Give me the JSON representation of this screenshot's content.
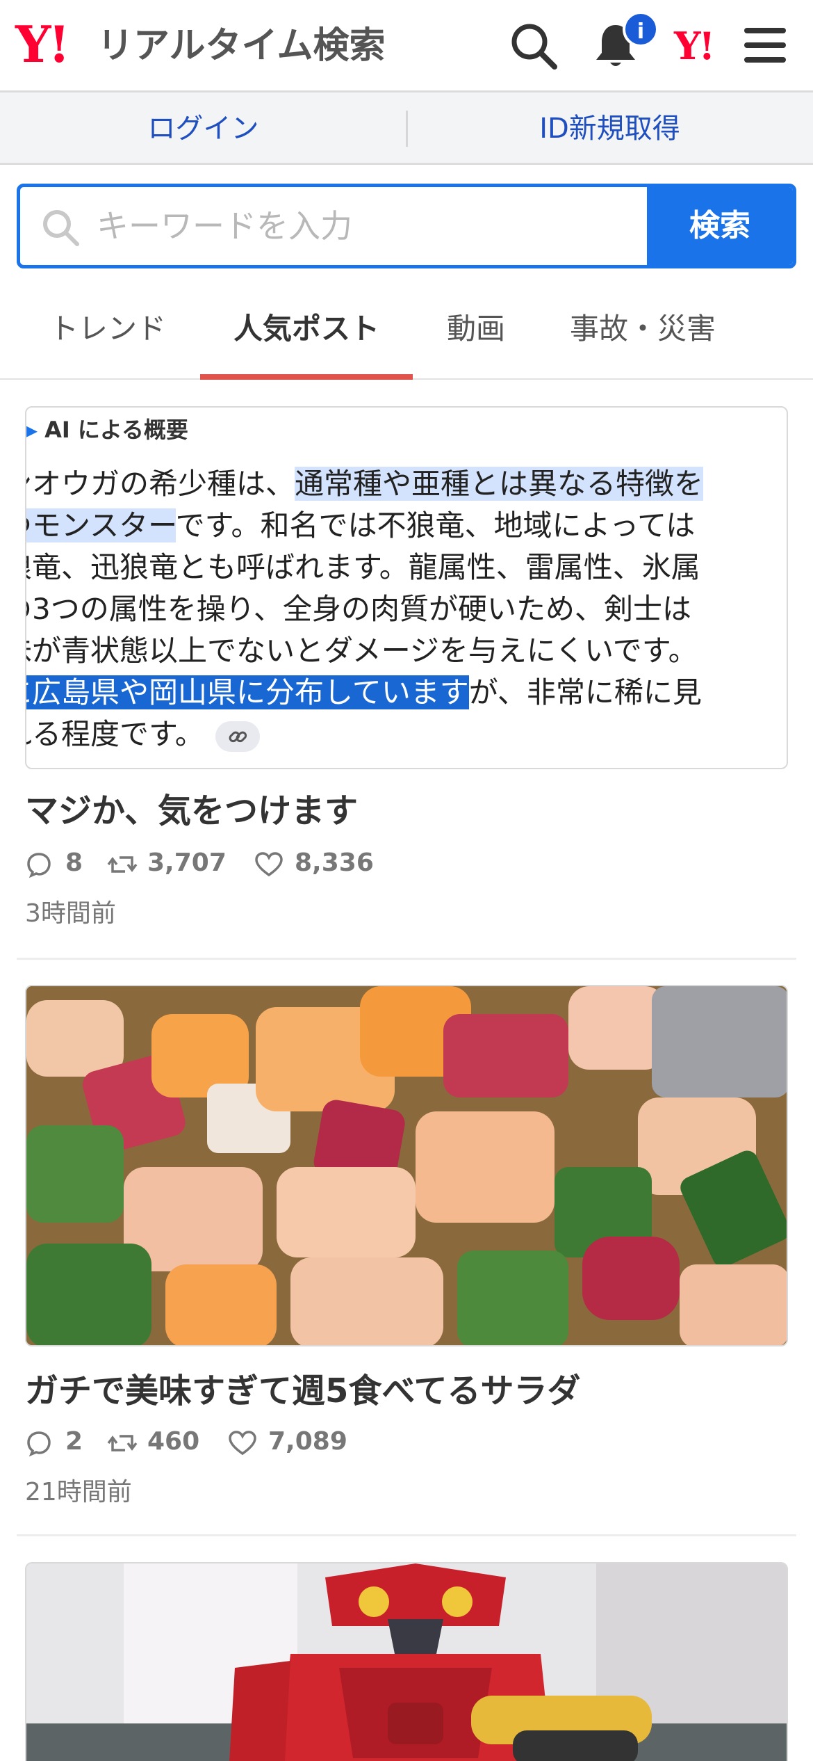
{
  "header": {
    "logo_y": "Y!",
    "logo_text": "リアルタイム検索",
    "notification_badge": "i",
    "yahoo_icon_text": "Y!"
  },
  "login_bar": {
    "login": "ログイン",
    "register": "ID新規取得"
  },
  "search": {
    "placeholder": "キーワードを入力",
    "button": "検索"
  },
  "tabs": [
    {
      "label": "トレンド",
      "active": false
    },
    {
      "label": "人気ポスト",
      "active": true
    },
    {
      "label": "動画",
      "active": false
    },
    {
      "label": "事故・災害",
      "active": false
    }
  ],
  "posts": [
    {
      "ai_summary": {
        "heading": "AI による概要",
        "lines": [
          [
            "ンオウガの希少種は、",
            "通常種や亜種とは異なる特徴を"
          ],
          [
            "つモンスター",
            "です。和名では不狼竜、地域によっては"
          ],
          [
            "狼竜、迅狼竜とも呼ばれます。龍属性、雷属性、氷属"
          ],
          [
            "の3つの属性を操り、全身の肉質が硬いため、剣士は"
          ],
          [
            "味が青状態以上でないとダメージを与えにくいです。"
          ],
          [
            "に広島県や岡山県に分布しています",
            "が、非常に稀に見"
          ],
          [
            "れる程度です。"
          ]
        ]
      },
      "title": "マジか、気をつけます",
      "replies": "8",
      "reposts": "3,707",
      "likes": "8,336",
      "time": "3時間前"
    },
    {
      "title": "ガチで美味すぎて週5食べてるサラダ",
      "replies": "2",
      "reposts": "460",
      "likes": "7,089",
      "time": "21時間前"
    }
  ],
  "colors": {
    "accent": "#1a73e8",
    "brand": "#ff0033",
    "tab_underline": "#e0524b"
  }
}
